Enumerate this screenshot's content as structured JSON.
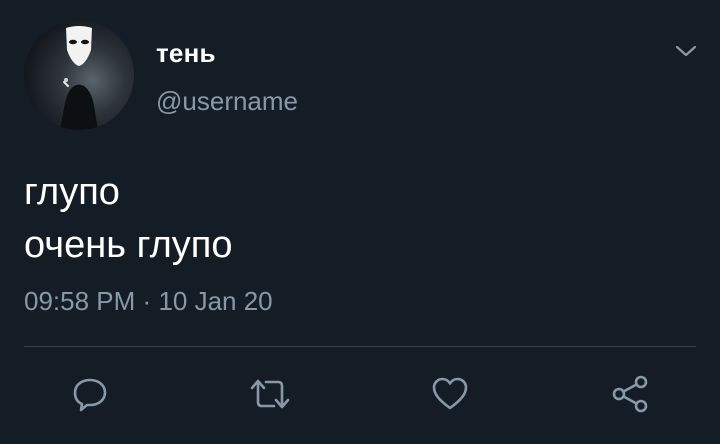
{
  "user": {
    "display_name": "тень",
    "username": "@username",
    "avatar": "avatar-mask-figure"
  },
  "tweet": {
    "lines": [
      "глупо",
      "очень глупо"
    ],
    "time": "09:58 PM",
    "separator": "·",
    "date": "10 Jan 20"
  },
  "actions": {
    "reply_icon": "comment-icon",
    "retweet_icon": "retweet-icon",
    "like_icon": "heart-icon",
    "share_icon": "share-icon"
  },
  "colors": {
    "background": "#141d26",
    "text": "#ffffff",
    "secondary": "#8899a6",
    "divider": "#38444d"
  }
}
